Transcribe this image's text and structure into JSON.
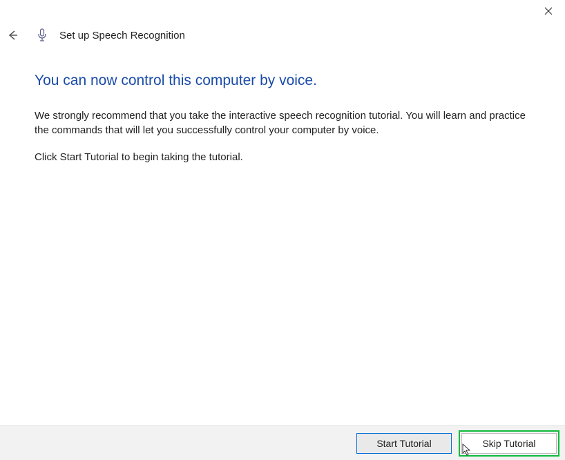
{
  "header": {
    "title": "Set up Speech Recognition"
  },
  "main": {
    "heading": "You can now control this computer by voice.",
    "paragraph1": "We strongly recommend that you take the interactive speech recognition tutorial. You will learn and practice the commands that will let you successfully control your computer by voice.",
    "paragraph2": "Click Start Tutorial to begin taking the tutorial."
  },
  "footer": {
    "start_label": "Start Tutorial",
    "skip_label": "Skip Tutorial"
  }
}
